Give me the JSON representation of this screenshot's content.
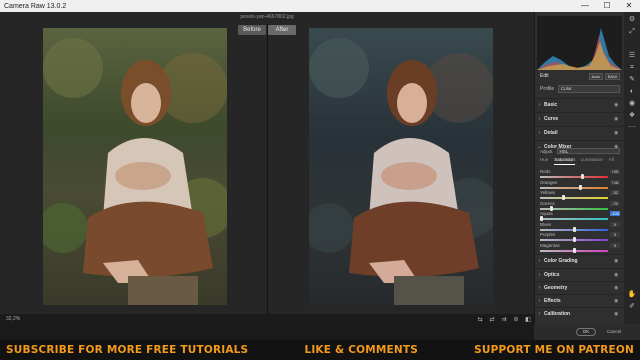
{
  "window": {
    "title": "Camera Raw 13.0.2",
    "filename": "pexels-yan-4667802.jpg",
    "minimize_glyph": "—",
    "maximize_glyph": "☐",
    "close_glyph": "✕"
  },
  "view": {
    "before_label": "Before",
    "after_label": "After",
    "zoom": "32,2%"
  },
  "histogram": {
    "colors": [
      "#3aa0e0",
      "#e04040",
      "#e0d040",
      "#ffffff"
    ]
  },
  "edit_panel": {
    "title": "Edit",
    "auto_label": "Auto",
    "bw_label": "B&W",
    "profile_label": "Profile",
    "profile_value": "Color",
    "sections_top": [
      "Basic",
      "Curve",
      "Detail"
    ],
    "color_mixer": {
      "title": "Color Mixer",
      "adjust_label": "Adjust",
      "adjust_value": "HSL",
      "tabs": [
        "Hue",
        "Saturation",
        "Luminance",
        "All"
      ],
      "active_tab": "Saturation",
      "sliders": [
        {
          "label": "Reds",
          "value": "+25",
          "fraction": 0.62,
          "colors": [
            "#bbbbbb",
            "#e03030"
          ]
        },
        {
          "label": "Oranges",
          "value": "+18",
          "fraction": 0.59,
          "colors": [
            "#bbbbbb",
            "#e08030"
          ]
        },
        {
          "label": "Yellows",
          "value": "-32",
          "fraction": 0.34,
          "colors": [
            "#bbbbbb",
            "#e0d030"
          ]
        },
        {
          "label": "Greens",
          "value": "-70",
          "fraction": 0.15,
          "colors": [
            "#bbbbbb",
            "#30c040"
          ]
        },
        {
          "label": "Aquas",
          "value": "-100",
          "fraction": 0.0,
          "colors": [
            "#bbbbbb",
            "#30c0c0"
          ],
          "highlight": true
        },
        {
          "label": "Blues",
          "value": "0",
          "fraction": 0.5,
          "colors": [
            "#bbbbbb",
            "#3060e0"
          ]
        },
        {
          "label": "Purples",
          "value": "0",
          "fraction": 0.5,
          "colors": [
            "#bbbbbb",
            "#8040d0"
          ]
        },
        {
          "label": "Magentas",
          "value": "0",
          "fraction": 0.5,
          "colors": [
            "#bbbbbb",
            "#d040c0"
          ]
        }
      ]
    },
    "sections_bottom": [
      "Color Grading",
      "Optics",
      "Geometry",
      "Effects",
      "Calibration"
    ]
  },
  "buttons": {
    "ok": "OK",
    "cancel": "Cancel"
  },
  "banner": {
    "left": "SUBSCRIBE FOR MORE FREE TUTORIALS",
    "center": "LIKE & COMMENTS",
    "right": "SUPPORT ME ON PATREON",
    "color": "#f39a1c"
  }
}
